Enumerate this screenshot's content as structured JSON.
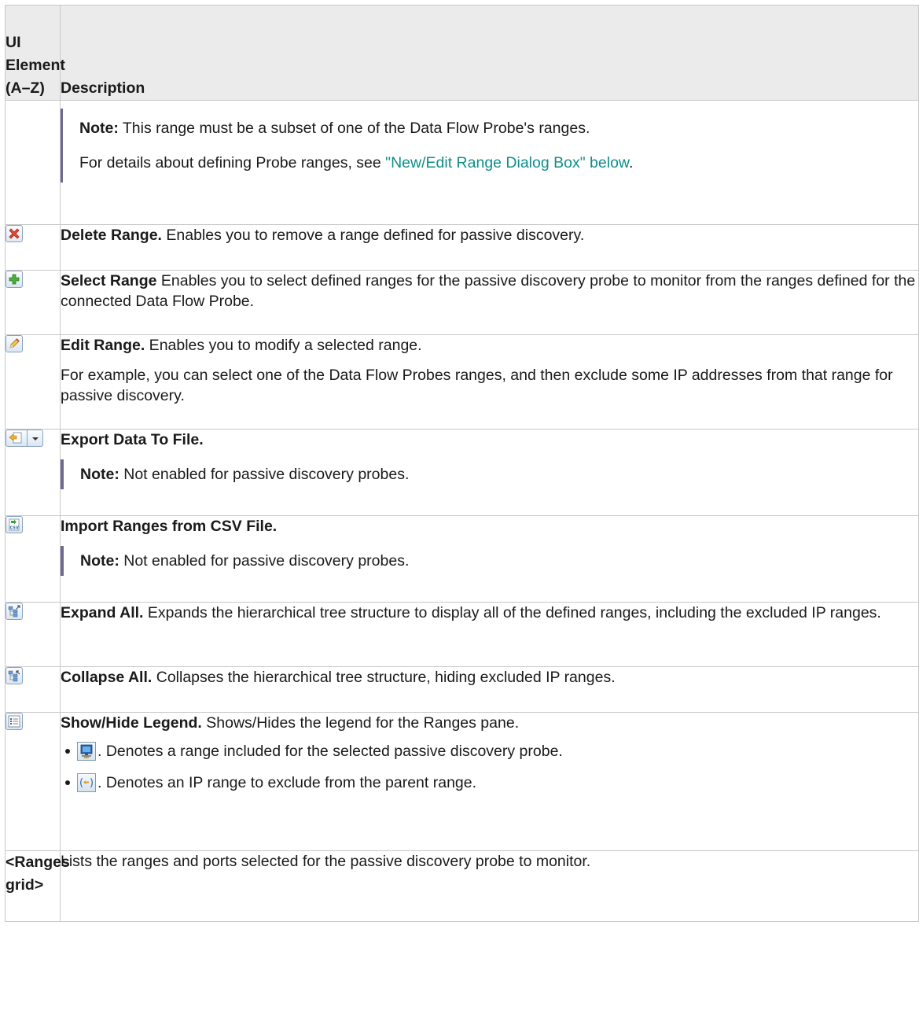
{
  "header": {
    "col1_line1": "UI",
    "col1_line2": "Element",
    "col1_line3": "(A–Z)",
    "col2": "Description"
  },
  "rows": {
    "cont": {
      "note_label": "Note:",
      "note_text": " This range must be a subset of one of the Data Flow Probe's ranges.",
      "details_text": "For details about defining Probe ranges, see ",
      "link_text": "\"New/Edit Range Dialog Box\" below",
      "details_end": "."
    },
    "delete": {
      "title": "Delete Range.",
      "text": " Enables you to remove a range defined for passive discovery."
    },
    "select": {
      "title": "Select Range",
      "text": " Enables you to select defined ranges for the passive discovery probe to monitor from the ranges defined for the connected Data Flow Probe."
    },
    "edit": {
      "title": "Edit Range.",
      "text": " Enables you to modify a selected range.",
      "text2": "For example, you can select one of the Data Flow Probes ranges, and then exclude some IP addresses from that range for passive discovery."
    },
    "export": {
      "title": "Export Data To File.",
      "note_label": "Note:",
      "note_text": " Not enabled for passive discovery probes."
    },
    "import": {
      "title": "Import Ranges from CSV File.",
      "note_label": "Note:",
      "note_text": " Not enabled for passive discovery probes."
    },
    "expand": {
      "title": "Expand All.",
      "text": " Expands the hierarchical tree structure to display all of the defined ranges, including the excluded IP ranges."
    },
    "collapse": {
      "title": "Collapse All.",
      "text": " Collapses the hierarchical tree structure, hiding excluded IP ranges."
    },
    "legend": {
      "title": "Show/Hide Legend.",
      "text": " Shows/Hides the legend for the Ranges pane.",
      "bullet1": ". Denotes a range included for the selected passive discovery probe.",
      "bullet2": ". Denotes an IP range to exclude from the parent range."
    },
    "grid": {
      "element_line1": "<Ranges",
      "element_line2": "grid>",
      "text": "Lists the ranges and ports selected for the passive discovery probe to monitor."
    }
  },
  "icons": {
    "delete": "delete-range-icon",
    "select": "add-range-icon",
    "edit": "edit-pencil-icon",
    "export": "export-data-icon",
    "import": "import-csv-icon",
    "expand": "expand-all-icon",
    "collapse": "collapse-all-icon",
    "legend": "legend-list-icon",
    "monitor": "monitor-range-icon",
    "exclude": "exclude-range-icon"
  },
  "colors": {
    "link": "#0e8f8a",
    "note_bar": "#6e6a8e",
    "header_bg": "#ebebeb",
    "border": "#c8c8c8"
  }
}
